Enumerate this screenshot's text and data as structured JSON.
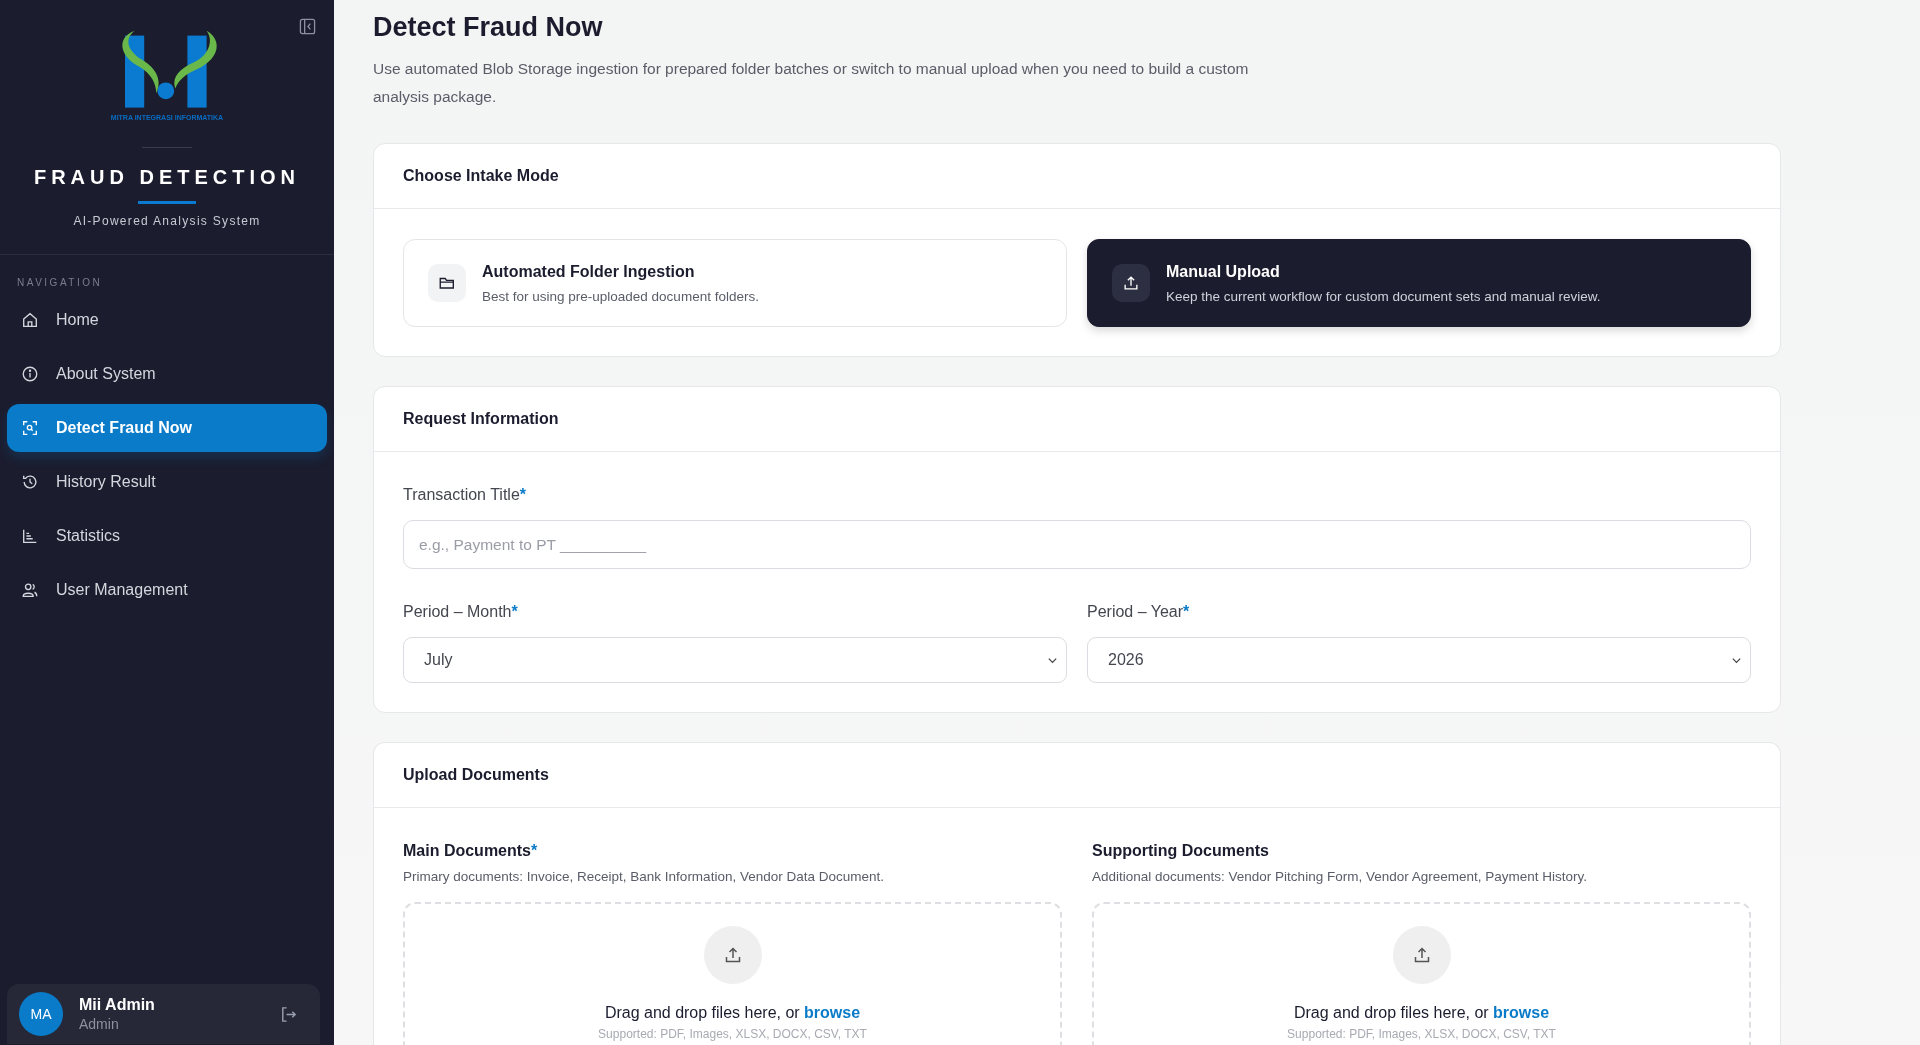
{
  "sidebar": {
    "logo_caption": "MITRA INTEGRASI INFORMATIKA",
    "app_title": "FRAUD DETECTION",
    "app_subtitle": "AI-Powered Analysis System",
    "nav_heading": "NAVIGATION",
    "items": [
      {
        "label": "Home",
        "kind": "home",
        "selected": false
      },
      {
        "label": "About System",
        "kind": "info",
        "selected": false
      },
      {
        "label": "Detect Fraud Now",
        "kind": "scan",
        "selected": true
      },
      {
        "label": "History Result",
        "kind": "history",
        "selected": false
      },
      {
        "label": "Statistics",
        "kind": "stats",
        "selected": false
      },
      {
        "label": "User Management",
        "kind": "users",
        "selected": false
      }
    ],
    "user": {
      "initials": "MA",
      "name": "Mii Admin",
      "role": "Admin"
    }
  },
  "page": {
    "title": "Detect Fraud Now",
    "description": "Use automated Blob Storage ingestion for prepared folder batches or switch to manual upload when you need to build a custom analysis package."
  },
  "intake": {
    "heading": "Choose Intake Mode",
    "options": [
      {
        "kind": "folder",
        "title": "Automated Folder Ingestion",
        "subtitle": "Best for using pre-uploaded document folders.",
        "selected": false
      },
      {
        "kind": "upload",
        "title": "Manual Upload",
        "subtitle": "Keep the current workflow for custom document sets and manual review.",
        "selected": true
      }
    ]
  },
  "request": {
    "heading": "Request Information",
    "title_field": {
      "label": "Transaction Title",
      "required_mark": "*",
      "placeholder": "e.g., Payment to PT __________"
    },
    "month": {
      "label": "Period – Month",
      "required_mark": "*",
      "value": "July"
    },
    "year": {
      "label": "Period – Year",
      "required_mark": "*",
      "value": "2026"
    }
  },
  "upload": {
    "heading": "Upload Documents",
    "zones": [
      {
        "title": "Main Documents",
        "required_mark": "*",
        "description": "Primary documents: Invoice, Receipt, Bank Information, Vendor Data Document.",
        "prompt": "Drag and drop files here, or",
        "link": "browse",
        "supported": "Supported: PDF, Images, XLSX, DOCX, CSV, TXT"
      },
      {
        "title": "Supporting Documents",
        "description": "Additional documents: Vendor Pitching Form, Vendor Agreement, Payment History.",
        "prompt": "Drag and drop files here, or",
        "link": "browse",
        "supported": "Supported: PDF, Images, XLSX, DOCX, CSV, TXT"
      }
    ]
  }
}
